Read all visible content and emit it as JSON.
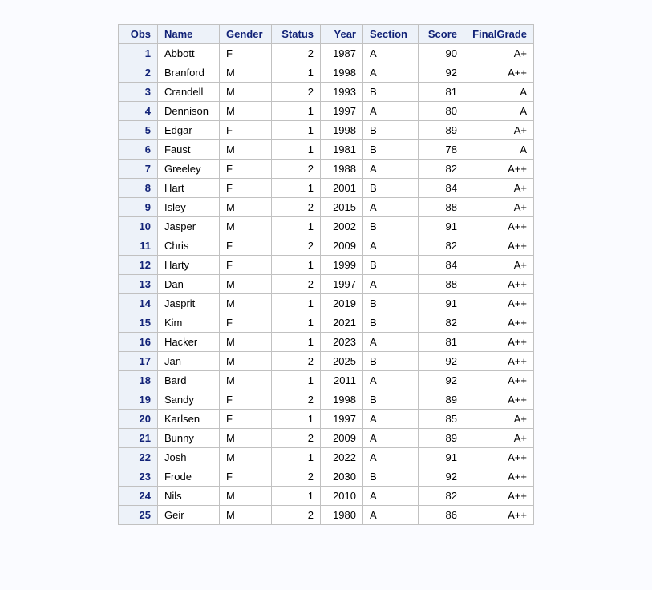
{
  "table": {
    "headers": {
      "obs": "Obs",
      "name": "Name",
      "gender": "Gender",
      "status": "Status",
      "year": "Year",
      "section": "Section",
      "score": "Score",
      "finalGrade": "FinalGrade"
    },
    "rows": [
      {
        "obs": 1,
        "name": "Abbott",
        "gender": "F",
        "status": 2,
        "year": 1987,
        "section": "A",
        "score": 90,
        "finalGrade": "A+"
      },
      {
        "obs": 2,
        "name": "Branford",
        "gender": "M",
        "status": 1,
        "year": 1998,
        "section": "A",
        "score": 92,
        "finalGrade": "A++"
      },
      {
        "obs": 3,
        "name": "Crandell",
        "gender": "M",
        "status": 2,
        "year": 1993,
        "section": "B",
        "score": 81,
        "finalGrade": "A"
      },
      {
        "obs": 4,
        "name": "Dennison",
        "gender": "M",
        "status": 1,
        "year": 1997,
        "section": "A",
        "score": 80,
        "finalGrade": "A"
      },
      {
        "obs": 5,
        "name": "Edgar",
        "gender": "F",
        "status": 1,
        "year": 1998,
        "section": "B",
        "score": 89,
        "finalGrade": "A+"
      },
      {
        "obs": 6,
        "name": "Faust",
        "gender": "M",
        "status": 1,
        "year": 1981,
        "section": "B",
        "score": 78,
        "finalGrade": "A"
      },
      {
        "obs": 7,
        "name": "Greeley",
        "gender": "F",
        "status": 2,
        "year": 1988,
        "section": "A",
        "score": 82,
        "finalGrade": "A++"
      },
      {
        "obs": 8,
        "name": "Hart",
        "gender": "F",
        "status": 1,
        "year": 2001,
        "section": "B",
        "score": 84,
        "finalGrade": "A+"
      },
      {
        "obs": 9,
        "name": "Isley",
        "gender": "M",
        "status": 2,
        "year": 2015,
        "section": "A",
        "score": 88,
        "finalGrade": "A+"
      },
      {
        "obs": 10,
        "name": "Jasper",
        "gender": "M",
        "status": 1,
        "year": 2002,
        "section": "B",
        "score": 91,
        "finalGrade": "A++"
      },
      {
        "obs": 11,
        "name": "Chris",
        "gender": "F",
        "status": 2,
        "year": 2009,
        "section": "A",
        "score": 82,
        "finalGrade": "A++"
      },
      {
        "obs": 12,
        "name": "Harty",
        "gender": "F",
        "status": 1,
        "year": 1999,
        "section": "B",
        "score": 84,
        "finalGrade": "A+"
      },
      {
        "obs": 13,
        "name": "Dan",
        "gender": "M",
        "status": 2,
        "year": 1997,
        "section": "A",
        "score": 88,
        "finalGrade": "A++"
      },
      {
        "obs": 14,
        "name": "Jasprit",
        "gender": "M",
        "status": 1,
        "year": 2019,
        "section": "B",
        "score": 91,
        "finalGrade": "A++"
      },
      {
        "obs": 15,
        "name": "Kim",
        "gender": "F",
        "status": 1,
        "year": 2021,
        "section": "B",
        "score": 82,
        "finalGrade": "A++"
      },
      {
        "obs": 16,
        "name": "Hacker",
        "gender": "M",
        "status": 1,
        "year": 2023,
        "section": "A",
        "score": 81,
        "finalGrade": "A++"
      },
      {
        "obs": 17,
        "name": "Jan",
        "gender": "M",
        "status": 2,
        "year": 2025,
        "section": "B",
        "score": 92,
        "finalGrade": "A++"
      },
      {
        "obs": 18,
        "name": "Bard",
        "gender": "M",
        "status": 1,
        "year": 2011,
        "section": "A",
        "score": 92,
        "finalGrade": "A++"
      },
      {
        "obs": 19,
        "name": "Sandy",
        "gender": "F",
        "status": 2,
        "year": 1998,
        "section": "B",
        "score": 89,
        "finalGrade": "A++"
      },
      {
        "obs": 20,
        "name": "Karlsen",
        "gender": "F",
        "status": 1,
        "year": 1997,
        "section": "A",
        "score": 85,
        "finalGrade": "A+"
      },
      {
        "obs": 21,
        "name": "Bunny",
        "gender": "M",
        "status": 2,
        "year": 2009,
        "section": "A",
        "score": 89,
        "finalGrade": "A+"
      },
      {
        "obs": 22,
        "name": "Josh",
        "gender": "M",
        "status": 1,
        "year": 2022,
        "section": "A",
        "score": 91,
        "finalGrade": "A++"
      },
      {
        "obs": 23,
        "name": "Frode",
        "gender": "F",
        "status": 2,
        "year": 2030,
        "section": "B",
        "score": 92,
        "finalGrade": "A++"
      },
      {
        "obs": 24,
        "name": "Nils",
        "gender": "M",
        "status": 1,
        "year": 2010,
        "section": "A",
        "score": 82,
        "finalGrade": "A++"
      },
      {
        "obs": 25,
        "name": "Geir",
        "gender": "M",
        "status": 2,
        "year": 1980,
        "section": "A",
        "score": 86,
        "finalGrade": "A++"
      }
    ]
  }
}
